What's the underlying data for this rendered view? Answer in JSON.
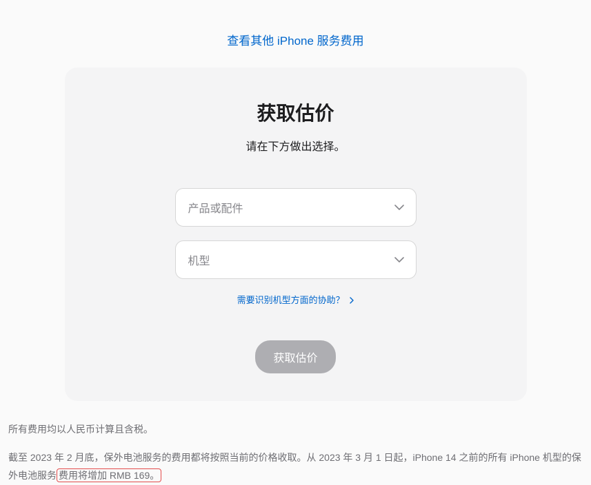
{
  "top_link": {
    "label": "查看其他 iPhone 服务费用"
  },
  "card": {
    "title": "获取估价",
    "subtitle": "请在下方做出选择。",
    "select_product_placeholder": "产品或配件",
    "select_model_placeholder": "机型",
    "help_label": "需要识别机型方面的协助？",
    "submit_label": "获取估价"
  },
  "footer": {
    "note1": "所有费用均以人民币计算且含税。",
    "note2_prefix": "截至 2023 年 2 月底，保外电池服务的费用都将按照当前的价格收取。从 2023 年 3 月 1 日起，iPhone 14 之前的所有 iPhone 机型的保外电池服务",
    "note2_highlight": "费用将增加 RMB 169。"
  }
}
